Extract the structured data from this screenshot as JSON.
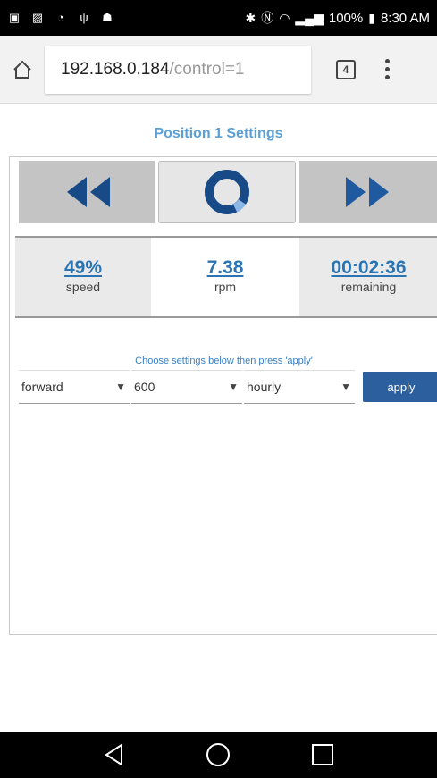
{
  "status_bar": {
    "battery": "100%",
    "time": "8:30 AM"
  },
  "browser": {
    "url_host": "192.168.0.184",
    "url_path": "/control=1",
    "tab_count": "4"
  },
  "page": {
    "title": "Position 1 Settings",
    "controls": {
      "rewind_icon": "rewind-icon",
      "status_icon": "progress-ring-icon",
      "forward_icon": "fast-forward-icon"
    },
    "stats": [
      {
        "value": "49%",
        "label": "speed"
      },
      {
        "value": "7.38",
        "label": "rpm"
      },
      {
        "value": "00:02:36",
        "label": "remaining"
      }
    ],
    "hint": "Choose settings below then press 'apply'",
    "settings": {
      "direction": "forward",
      "amount": "600",
      "interval": "hourly",
      "apply_label": "apply"
    }
  },
  "colors": {
    "accent_blue": "#2b74b3",
    "title_blue": "#5a9fd6",
    "apply_bg": "#2c5f9e",
    "icon_dark_blue": "#174a86"
  }
}
